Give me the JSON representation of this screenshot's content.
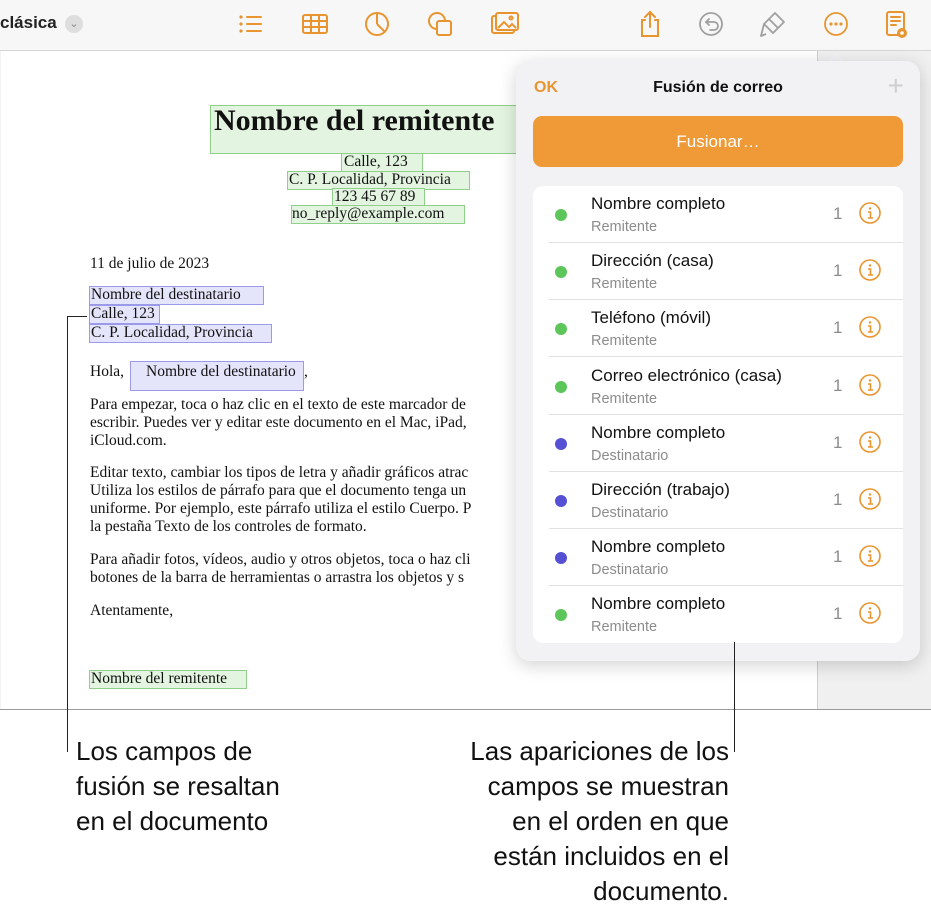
{
  "toolbar": {
    "doc_title": "clásica",
    "icons": [
      "list-icon",
      "table-icon",
      "chart-icon",
      "shapes-icon",
      "media-icon",
      "share-icon",
      "undo-icon",
      "format-brush-icon",
      "more-icon",
      "reader-icon"
    ]
  },
  "document": {
    "sender_name": "Nombre del remitente",
    "sender_street": "Calle, 123",
    "sender_city": "C. P. Localidad, Provincia",
    "sender_phone": "123 45 67 89",
    "sender_email": "no_reply@example.com",
    "date": "11 de julio de 2023",
    "recipient_name": "Nombre del destinatario",
    "recipient_street": "Calle, 123",
    "recipient_city": "C. P. Localidad, Provincia",
    "greeting_prefix": "Hola,",
    "greeting_name": "Nombre del destinatario",
    "greeting_suffix": ",",
    "p1": [
      "Para empezar, toca o haz clic en el texto de este marcador de",
      "escribir. Puedes ver y editar este documento en el Mac, iPad,",
      "iCloud.com."
    ],
    "p2": [
      "Editar texto, cambiar los tipos de letra y añadir gráficos atrac",
      "Utiliza los estilos de párrafo para que el documento tenga un",
      "uniforme. Por ejemplo, este párrafo utiliza el estilo Cuerpo. P",
      "la pestaña Texto de los controles de formato."
    ],
    "p3": [
      "Para añadir fotos, vídeos, audio y otros objetos, toca o haz cli",
      "botones de la barra de herramientas o arrastra los objetos y s"
    ],
    "closing": "Atentamente,",
    "signature": "Nombre del remitente"
  },
  "popover": {
    "ok_label": "OK",
    "title": "Fusión de correo",
    "add_label": "+",
    "merge_button": "Fusionar…",
    "rows": [
      {
        "title": "Nombre completo",
        "subtitle": "Remitente",
        "count": "1",
        "dot_color": "#5cc65a"
      },
      {
        "title": "Dirección (casa)",
        "subtitle": "Remitente",
        "count": "1",
        "dot_color": "#5cc65a"
      },
      {
        "title": "Teléfono (móvil)",
        "subtitle": "Remitente",
        "count": "1",
        "dot_color": "#5cc65a"
      },
      {
        "title": "Correo electrónico (casa)",
        "subtitle": "Remitente",
        "count": "1",
        "dot_color": "#5cc65a"
      },
      {
        "title": "Nombre completo",
        "subtitle": "Destinatario",
        "count": "1",
        "dot_color": "#5651d4"
      },
      {
        "title": "Dirección (trabajo)",
        "subtitle": "Destinatario",
        "count": "1",
        "dot_color": "#5651d4"
      },
      {
        "title": "Nombre completo",
        "subtitle": "Destinatario",
        "count": "1",
        "dot_color": "#5651d4"
      },
      {
        "title": "Nombre completo",
        "subtitle": "Remitente",
        "count": "1",
        "dot_color": "#5cc65a"
      }
    ]
  },
  "callouts": {
    "left": [
      "Los campos de",
      "fusión se resaltan",
      "en el documento"
    ],
    "right": [
      "Las apariciones de los",
      "campos se muestran",
      "en el orden en que",
      "están incluidos en el",
      "documento."
    ]
  },
  "colors": {
    "accent": "#ef9a37",
    "sender_field": "#5cc65a",
    "recipient_field": "#5651d4"
  }
}
